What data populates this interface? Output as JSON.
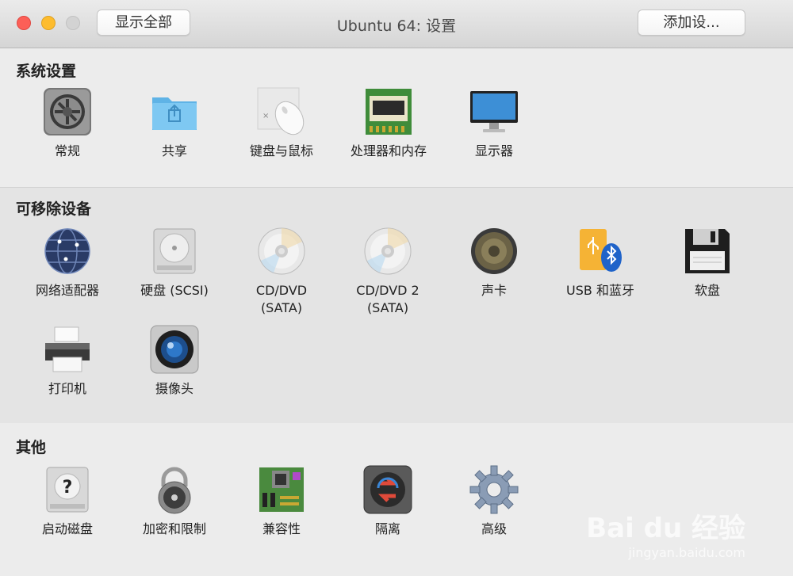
{
  "window": {
    "title": "Ubuntu 64: 设置",
    "show_all_label": "显示全部",
    "add_device_label": "添加设..."
  },
  "sections": {
    "system": {
      "title": "系统设置",
      "items": [
        {
          "label": "常规",
          "icon": "gear-switch-icon"
        },
        {
          "label": "共享",
          "icon": "shared-folder-icon"
        },
        {
          "label": "键盘与鼠标",
          "icon": "keyboard-mouse-icon"
        },
        {
          "label": "处理器和内存",
          "icon": "memory-chip-icon"
        },
        {
          "label": "显示器",
          "icon": "monitor-icon"
        }
      ]
    },
    "removable": {
      "title": "可移除设备",
      "items": [
        {
          "label": "网络适配器",
          "icon": "network-globe-icon"
        },
        {
          "label": "硬盘 (SCSI)",
          "icon": "hard-disk-icon"
        },
        {
          "label": "CD/DVD\n(SATA)",
          "icon": "disc-icon"
        },
        {
          "label": "CD/DVD 2\n(SATA)",
          "icon": "disc-icon"
        },
        {
          "label": "声卡",
          "icon": "speaker-icon"
        },
        {
          "label": "USB 和蓝牙",
          "icon": "usb-bluetooth-icon"
        },
        {
          "label": "软盘",
          "icon": "floppy-icon"
        },
        {
          "label": "打印机",
          "icon": "printer-icon"
        },
        {
          "label": "摄像头",
          "icon": "camera-icon"
        }
      ]
    },
    "other": {
      "title": "其他",
      "items": [
        {
          "label": "启动磁盘",
          "icon": "startup-disk-icon"
        },
        {
          "label": "加密和限制",
          "icon": "padlock-icon"
        },
        {
          "label": "兼容性",
          "icon": "motherboard-icon"
        },
        {
          "label": "隔离",
          "icon": "isolation-icon"
        },
        {
          "label": "高级",
          "icon": "advanced-gear-icon"
        }
      ]
    }
  },
  "watermark": {
    "brand": "Bai du 经验",
    "url": "jingyan.baidu.com"
  }
}
